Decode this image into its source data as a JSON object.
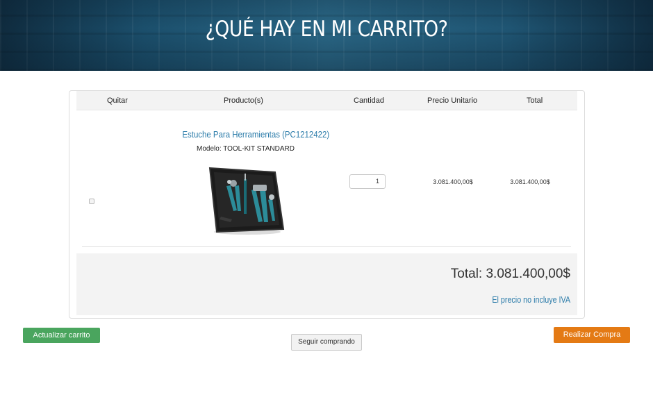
{
  "hero": {
    "title": "¿QUÉ HAY EN MI CARRITO?"
  },
  "table": {
    "headers": {
      "remove": "Quitar",
      "product": "Producto(s)",
      "quantity": "Cantidad",
      "unit_price": "Precio Unitario",
      "total": "Total"
    }
  },
  "item": {
    "name": "Estuche Para Herramientas (PC1212422)",
    "model": "Modelo: TOOL-KIT STANDARD",
    "quantity": "1",
    "unit_price": "3.081.400,00$",
    "total": "3.081.400,00$",
    "image_icon": "tool-kit-case-icon"
  },
  "summary": {
    "total": "Total: 3.081.400,00$",
    "iva_note": "El precio no incluye IVA"
  },
  "buttons": {
    "update": "Actualizar carrito",
    "continue": "Seguir comprando",
    "checkout": "Realizar Compra"
  },
  "colors": {
    "accent_link": "#2a7ba9",
    "update_button": "#4aa55e",
    "checkout_button": "#e47a14",
    "hero_background": "#1b4f6c"
  }
}
